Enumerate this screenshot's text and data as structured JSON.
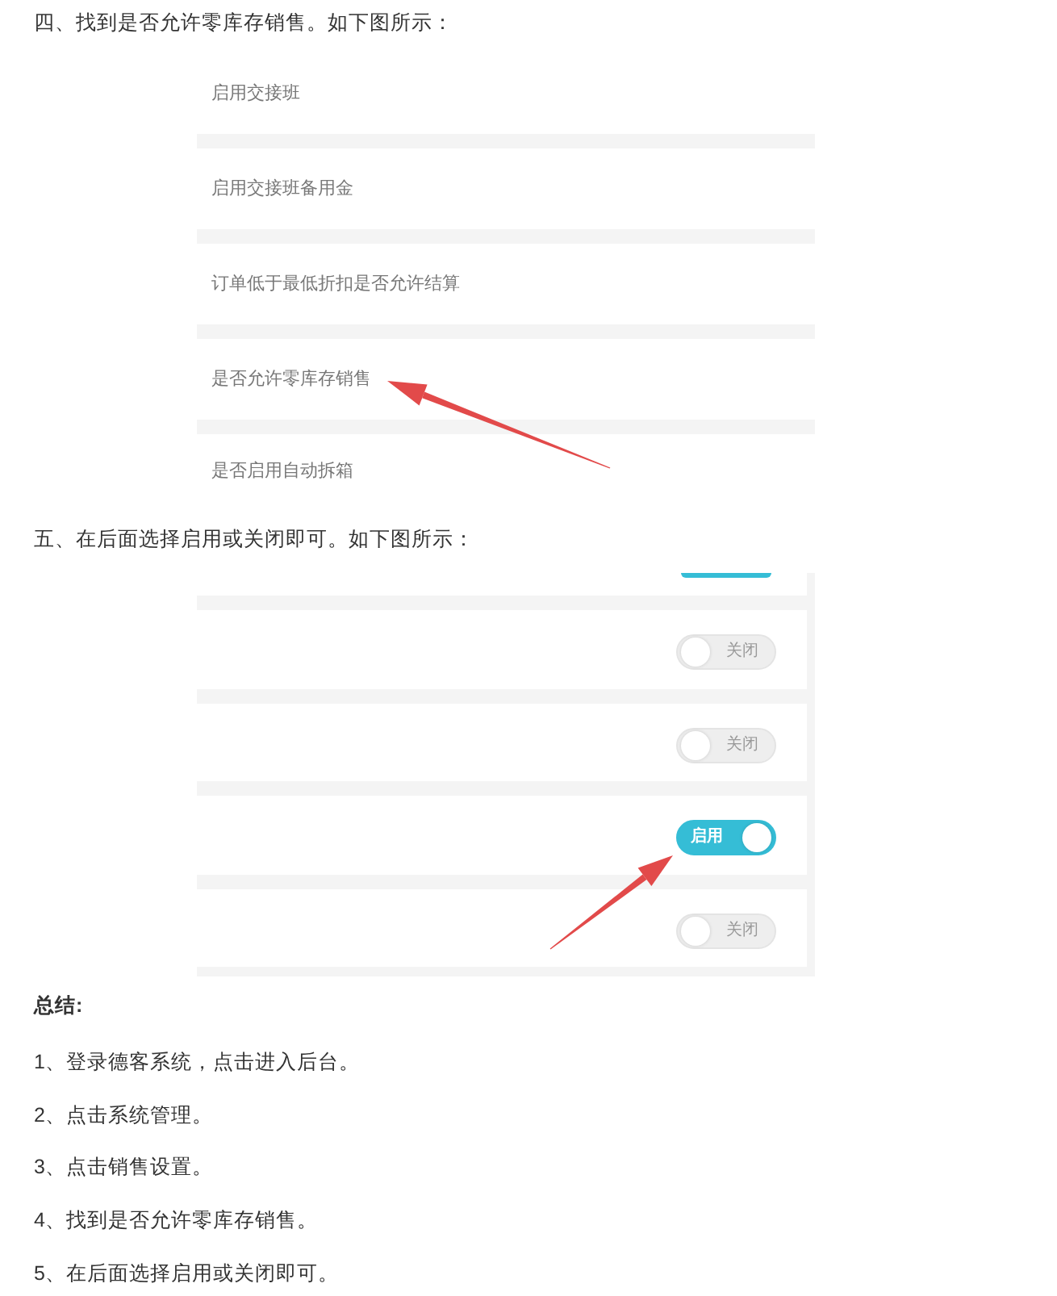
{
  "step_4": {
    "heading": "四、找到是否允许零库存销售。如下图所示：",
    "screenshot": {
      "settings": [
        {
          "label": "启用交接班",
          "pointed": false
        },
        {
          "label": "启用交接班备用金",
          "pointed": false
        },
        {
          "label": "订单低于最低折扣是否允许结算",
          "pointed": false
        },
        {
          "label": "是否允许零库存销售",
          "pointed": true
        },
        {
          "label": "是否启用自动拆箱",
          "pointed": false
        }
      ]
    }
  },
  "step_5": {
    "heading": "五、在后面选择启用或关闭即可。如下图所示：",
    "screenshot": {
      "toggles": [
        {
          "kind": "clipped",
          "on": true,
          "pointed": false
        },
        {
          "kind": "full",
          "on": false,
          "label": "关闭",
          "pointed": false
        },
        {
          "kind": "full",
          "on": false,
          "label": "关闭",
          "pointed": false
        },
        {
          "kind": "full",
          "on": true,
          "label": "启用",
          "pointed": true
        },
        {
          "kind": "full",
          "on": false,
          "label": "关闭",
          "pointed": false
        }
      ]
    }
  },
  "summary": {
    "title": "总结:",
    "items": [
      "1、登录德客系统，点击进入后台。",
      "2、点击系统管理。",
      "3、点击销售设置。",
      "4、找到是否允许零库存销售。",
      "5、在后面选择启用或关闭即可。"
    ]
  }
}
